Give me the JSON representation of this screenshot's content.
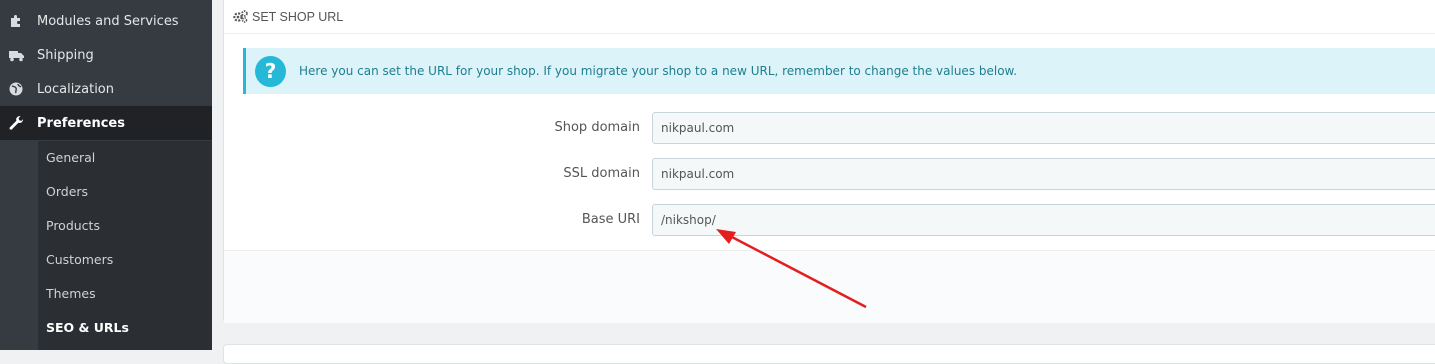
{
  "sidebar": {
    "items": [
      {
        "label": "Modules and Services",
        "icon": "puzzle-icon"
      },
      {
        "label": "Shipping",
        "icon": "truck-icon"
      },
      {
        "label": "Localization",
        "icon": "globe-icon"
      },
      {
        "label": "Preferences",
        "icon": "wrench-icon"
      }
    ],
    "submenu": [
      "General",
      "Orders",
      "Products",
      "Customers",
      "Themes",
      "SEO & URLs"
    ]
  },
  "panel": {
    "title": "SET SHOP URL",
    "alert": "Here you can set the URL for your shop. If you migrate your shop to a new URL, remember to change the values below.",
    "fields": [
      {
        "label": "Shop domain",
        "value": "nikpaul.com"
      },
      {
        "label": "SSL domain",
        "value": "nikpaul.com"
      },
      {
        "label": "Base URI",
        "value": "/nikshop/"
      }
    ]
  },
  "colors": {
    "sidebar_bg": "#363a41",
    "active_bg": "#202226",
    "alert_bg": "#dcf4f9",
    "alert_accent": "#25b9d7",
    "annotation_arrow": "#e41e1e"
  }
}
